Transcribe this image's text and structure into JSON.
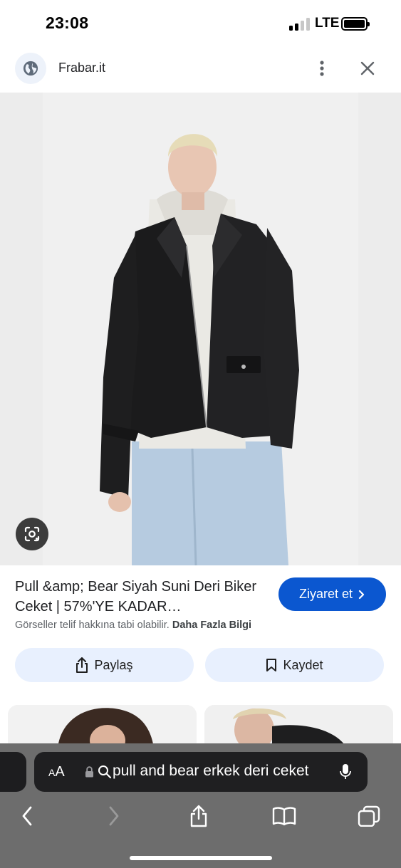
{
  "status": {
    "time": "23:08",
    "network": "LTE"
  },
  "header": {
    "site_name": "Frabar.it",
    "icons": [
      "globe-icon",
      "more-vert-icon",
      "close-icon"
    ]
  },
  "result": {
    "title": "Pull &amp; Bear Siyah Suni Deri Biker Ceket | 57%'YE KADAR…",
    "visit_label": "Ziyaret et",
    "copyright_text": "Görseller telif hakkına tabi olabilir.",
    "more_info_link": "Daha Fazla Bilgi",
    "share_label": "Paylaş",
    "save_label": "Kaydet"
  },
  "browser": {
    "aa_small": "A",
    "aa_big": "A",
    "url_text": "pull and bear erkek deri ceket",
    "icons": [
      "back-icon",
      "forward-icon",
      "share-icon",
      "bookmarks-icon",
      "tabs-icon",
      "microphone-icon",
      "lock-icon",
      "search-icon"
    ]
  },
  "colors": {
    "accent": "#0b57d0",
    "action_bg": "#e8f0fe",
    "toolbar_bg": "#6d6d6d",
    "url_bar_bg": "#1f1f21"
  }
}
